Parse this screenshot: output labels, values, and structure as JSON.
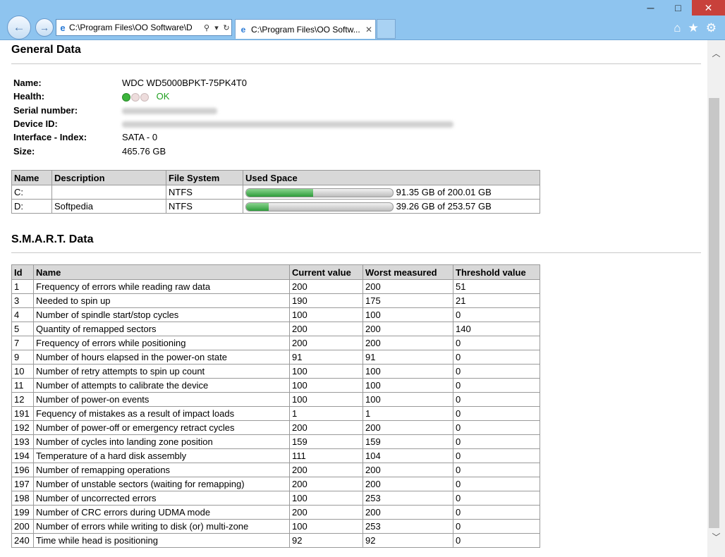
{
  "window": {
    "address": "C:\\Program Files\\OO Software\\D",
    "tab_title": "C:\\Program Files\\OO Softw...",
    "minimize_glyph": "─",
    "maximize_glyph": "□",
    "close_glyph": "✕",
    "tab_close_glyph": "✕",
    "back_glyph": "←",
    "forward_glyph": "→",
    "search_glyph": "⚲",
    "dropdown_glyph": "▾",
    "refresh_glyph": "↻",
    "home_glyph": "⌂",
    "favorites_glyph": "★",
    "tools_glyph": "⚙",
    "scroll_up_glyph": "︿",
    "scroll_down_glyph": "﹀"
  },
  "general": {
    "heading": "General Data",
    "name_label": "Name:",
    "name_value": "WDC WD5000BPKT-75PK4T0",
    "health_label": "Health:",
    "health_value": "OK",
    "serial_label": "Serial number:",
    "device_label": "Device ID:",
    "interface_label": "Interface - Index:",
    "interface_value": "SATA - 0",
    "size_label": "Size:",
    "size_value": "465.76 GB"
  },
  "partitions": {
    "headers": [
      "Name",
      "Description",
      "File System",
      "Used Space"
    ],
    "rows": [
      {
        "name": "C:",
        "description": "",
        "fs": "NTFS",
        "used_fraction": 0.457,
        "used_text": "91.35 GB of 200.01 GB"
      },
      {
        "name": "D:",
        "description": "Softpedia",
        "fs": "NTFS",
        "used_fraction": 0.155,
        "used_text": "39.26 GB of 253.57 GB"
      }
    ]
  },
  "smart": {
    "heading": "S.M.A.R.T. Data",
    "headers": [
      "Id",
      "Name",
      "Current value",
      "Worst measured",
      "Threshold value"
    ],
    "rows": [
      [
        "1",
        "Frequency of errors while reading raw data",
        "200",
        "200",
        "51"
      ],
      [
        "3",
        "Needed to spin up",
        "190",
        "175",
        "21"
      ],
      [
        "4",
        "Number of spindle start/stop cycles",
        "100",
        "100",
        "0"
      ],
      [
        "5",
        "Quantity of remapped sectors",
        "200",
        "200",
        "140"
      ],
      [
        "7",
        "Frequency of errors while positioning",
        "200",
        "200",
        "0"
      ],
      [
        "9",
        "Number of hours elapsed in the power-on state",
        "91",
        "91",
        "0"
      ],
      [
        "10",
        "Number of retry attempts to spin up count",
        "100",
        "100",
        "0"
      ],
      [
        "11",
        "Number of attempts to calibrate the device",
        "100",
        "100",
        "0"
      ],
      [
        "12",
        "Number of power-on events",
        "100",
        "100",
        "0"
      ],
      [
        "191",
        "Fequency of mistakes as a result of impact loads",
        "1",
        "1",
        "0"
      ],
      [
        "192",
        "Number of power-off or emergency retract cycles",
        "200",
        "200",
        "0"
      ],
      [
        "193",
        "Number of cycles into landing zone position",
        "159",
        "159",
        "0"
      ],
      [
        "194",
        "Temperature of a hard disk assembly",
        "111",
        "104",
        "0"
      ],
      [
        "196",
        "Number of remapping operations",
        "200",
        "200",
        "0"
      ],
      [
        "197",
        "Number of unstable sectors (waiting for remapping)",
        "200",
        "200",
        "0"
      ],
      [
        "198",
        "Number of uncorrected errors",
        "100",
        "253",
        "0"
      ],
      [
        "199",
        "Number of CRC errors during UDMA mode",
        "200",
        "200",
        "0"
      ],
      [
        "200",
        "Number of errors while writing to disk (or) multi-zone",
        "100",
        "253",
        "0"
      ],
      [
        "240",
        "Time while head is positioning",
        "92",
        "92",
        "0"
      ]
    ]
  },
  "colors": {
    "health_ok": "#1fa01f",
    "health_dot_on": "#3cb43c",
    "health_dot_off": "#e8c8c8"
  }
}
